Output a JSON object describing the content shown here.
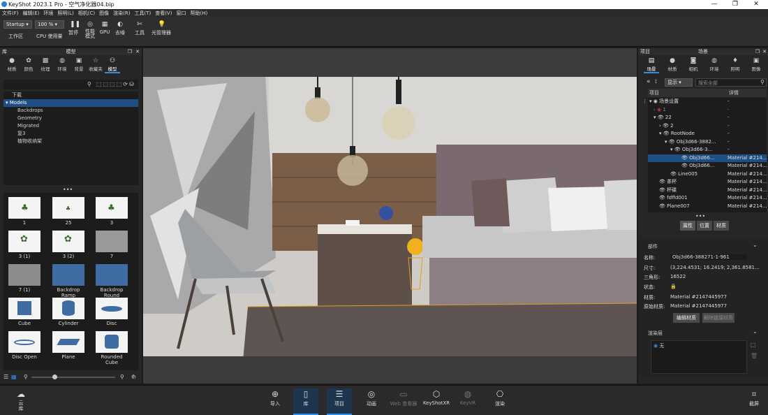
{
  "window": {
    "title": "KeyShot 2023.1 Pro  - 空气净化器04.bip"
  },
  "menu": [
    "文件(F)",
    "编辑(E)",
    "环境",
    "照明(L)",
    "相机(C)",
    "图像",
    "渲染(R)",
    "工具(T)",
    "查看(V)",
    "窗口",
    "帮助(H)"
  ],
  "ribbon": {
    "workspace_value": "Startup",
    "workspace_label": "工作区",
    "zoom_value": "100 %",
    "cpu_label": "CPU 使用量",
    "pause_label": "暂停",
    "perf_label": "性能\n模式",
    "gpu_label": "GPU",
    "denoise_label": "去噪",
    "tools_label": "工具",
    "light_label": "光管理器"
  },
  "library": {
    "header": "库",
    "title": "模型",
    "tabs": [
      {
        "label": "材质",
        "icon": "material-icon"
      },
      {
        "label": "颜色",
        "icon": "palette-icon"
      },
      {
        "label": "纹理",
        "icon": "texture-icon"
      },
      {
        "label": "环境",
        "icon": "globe-icon"
      },
      {
        "label": "背景",
        "icon": "image-icon"
      },
      {
        "label": "收藏夹",
        "icon": "star-icon"
      },
      {
        "label": "模型",
        "icon": "model-icon"
      }
    ],
    "tree": [
      {
        "label": "下载",
        "indent": 0
      },
      {
        "label": "Models",
        "indent": 0,
        "selected": true
      },
      {
        "label": "Backdrops",
        "indent": 1
      },
      {
        "label": "Geometry",
        "indent": 1
      },
      {
        "label": "Migrated",
        "indent": 1
      },
      {
        "label": "复3",
        "indent": 1
      },
      {
        "label": "植物收纳架",
        "indent": 1
      }
    ],
    "tiles": [
      "1",
      "25",
      "3",
      "3 (1)",
      "3 (2)",
      "7",
      "7 (1)",
      "Backdrop Ramp",
      "Backdrop Round",
      "Cube",
      "Cylinder",
      "Disc",
      "Disc Open",
      "Plane",
      "Rounded Cube"
    ]
  },
  "scene": {
    "header": "项目",
    "title": "场景",
    "tabs": [
      {
        "label": "场景",
        "icon": "scene-icon"
      },
      {
        "label": "材质",
        "icon": "material-icon"
      },
      {
        "label": "相机",
        "icon": "camera-icon"
      },
      {
        "label": "环境",
        "icon": "globe-icon"
      },
      {
        "label": "照明",
        "icon": "bulb-icon"
      },
      {
        "label": "图像",
        "icon": "image-icon"
      }
    ],
    "filter_value": "显示",
    "search_placeholder": "搜索全部",
    "col_item": "项目",
    "col_detail": "详情",
    "rows": [
      {
        "label": "场景设置",
        "detail": "-",
        "indent": 0
      },
      {
        "label": "1",
        "detail": "-",
        "indent": 1
      },
      {
        "label": "22",
        "detail": "-",
        "indent": 1
      },
      {
        "label": "2",
        "detail": "-",
        "indent": 2
      },
      {
        "label": "RootNode",
        "detail": "-",
        "indent": 2
      },
      {
        "label": "Obj3d66-3882...",
        "detail": "-",
        "indent": 3
      },
      {
        "label": "Obj3d66-3...",
        "detail": "-",
        "indent": 4
      },
      {
        "label": "Obj3d66...",
        "detail": "Material #214...",
        "indent": 5,
        "selected": true
      },
      {
        "label": "Obj3d66...",
        "detail": "Material #214...",
        "indent": 5
      },
      {
        "label": "Line005",
        "detail": "Material #214...",
        "indent": 3
      },
      {
        "label": "茶杯",
        "detail": "Material #214...",
        "indent": 1
      },
      {
        "label": "杯碟",
        "detail": "Material #214...",
        "indent": 1
      },
      {
        "label": "fdffd001",
        "detail": "Material #214...",
        "indent": 1
      },
      {
        "label": "Plane007",
        "detail": "Material #214...",
        "indent": 1
      }
    ],
    "subtabs": [
      "属性",
      "位置",
      "材质"
    ],
    "section_part": "部件",
    "name_label": "名称:",
    "name_value": "Obj3d66-388271-1-961",
    "size_label": "尺寸:",
    "size_value": "(3,224.4531; 16.2419; 2,361.8581...",
    "tri_label": "三角形:",
    "tri_value": "16522",
    "state_label": "状态:",
    "mat_label": "材质:",
    "mat_value": "Material #2147445977",
    "orig_label": "原始材质:",
    "orig_value": "Material #2147445977",
    "edit_mat_btn": "编辑材质",
    "unlink_btn": "解除链接材质",
    "section_layer": "渲染层",
    "layer_item": "无"
  },
  "bottom": {
    "cloud": "云\n库",
    "buttons": [
      {
        "label": "导入",
        "icon": "import-icon"
      },
      {
        "label": "库",
        "icon": "book-icon",
        "active": true
      },
      {
        "label": "项目",
        "icon": "project-icon",
        "active": true
      },
      {
        "label": "动画",
        "icon": "animation-icon"
      },
      {
        "label": "Web 查看器",
        "icon": "monitor-icon",
        "dim": true
      },
      {
        "label": "KeyShotXR",
        "icon": "xr-icon"
      },
      {
        "label": "KeyVR",
        "icon": "vr-icon",
        "dim": true
      },
      {
        "label": "渲染",
        "icon": "render-icon"
      }
    ],
    "screenshot": "截屏"
  },
  "colors": {
    "accent": "#2f8fe8",
    "selection": "#1f4f82",
    "highlight_outline": "#e0a020"
  }
}
